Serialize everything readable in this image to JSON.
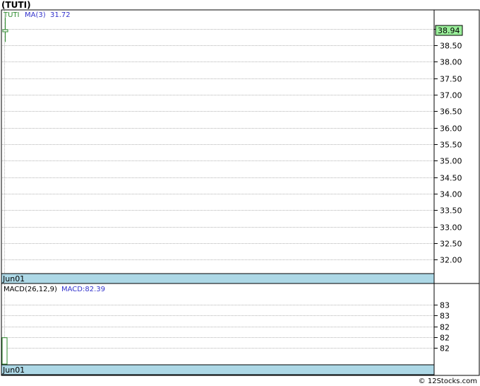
{
  "title": "(TUTI)",
  "credit": "© 12Stocks.com",
  "chart_data": [
    {
      "type": "candlestick",
      "panel": "price",
      "legend": {
        "symbol": "TUTI",
        "ma_label": "MA(3)",
        "ma_value": "31.72"
      },
      "ylim": [
        31.6,
        39.55
      ],
      "yticks": [
        "39.00",
        "38.50",
        "38.00",
        "37.50",
        "37.00",
        "36.50",
        "36.00",
        "35.50",
        "35.00",
        "34.50",
        "34.00",
        "33.50",
        "33.00",
        "32.50",
        "32.00"
      ],
      "x": [
        "Jun01"
      ],
      "xlabel": "Jun01",
      "candles": [
        {
          "open": 38.94,
          "high": 39.35,
          "low": 38.6,
          "close": 38.94
        }
      ],
      "last_price": "38.94",
      "grid": true,
      "colors": {
        "up": "#2e8b2e",
        "ma": "#3333cc",
        "last_price_bg": "#99ee99",
        "axis_band": "#add8e6"
      }
    },
    {
      "type": "bar",
      "panel": "macd",
      "legend": {
        "indicator": "MACD(26,12,9)",
        "value_label": "MACD:82.39"
      },
      "ylim": [
        81.9,
        83.2
      ],
      "yticks": [
        "83",
        "83",
        "82",
        "82",
        "82"
      ],
      "ytick_values": [
        83.0,
        82.8,
        82.6,
        82.4,
        82.2
      ],
      "x": [
        "Jun01"
      ],
      "xlabel": "Jun01",
      "values": [
        82.39
      ],
      "grid": true,
      "colors": {
        "bar": "#2e8b2e",
        "value_label": "#3333cc",
        "axis_band": "#add8e6"
      }
    }
  ]
}
